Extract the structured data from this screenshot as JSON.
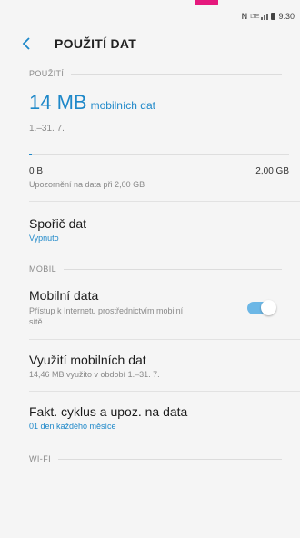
{
  "status_bar": {
    "network_label": "LTE",
    "time": "9:30"
  },
  "header": {
    "title": "POUŽITÍ DAT"
  },
  "usage_section": {
    "heading": "POUŽITÍ",
    "amount": "14 MB",
    "amount_label": "mobilních dat",
    "period": "1.–31. 7.",
    "progress_fraction": 0.01,
    "scale_min": "0 B",
    "scale_max": "2,00 GB",
    "warning": "Upozornění na data při 2,00 GB"
  },
  "data_saver": {
    "title": "Spořič dat",
    "status": "Vypnuto"
  },
  "mobile_section": {
    "heading": "MOBIL",
    "mobile_data": {
      "title": "Mobilní data",
      "description": "Přístup k Internetu prostřednictvím mobilní sítě.",
      "enabled": true
    },
    "usage": {
      "title": "Využití mobilních dat",
      "description": "14,46 MB využito v období 1.–31. 7."
    },
    "billing": {
      "title": "Fakt. cyklus a upoz. na data",
      "description": "01 den každého měsíce"
    }
  },
  "wifi_section": {
    "heading": "WI-FI"
  },
  "colors": {
    "accent": "#1e88c9",
    "toggle_on": "#6cb7e6",
    "marker": "#e5197d"
  }
}
